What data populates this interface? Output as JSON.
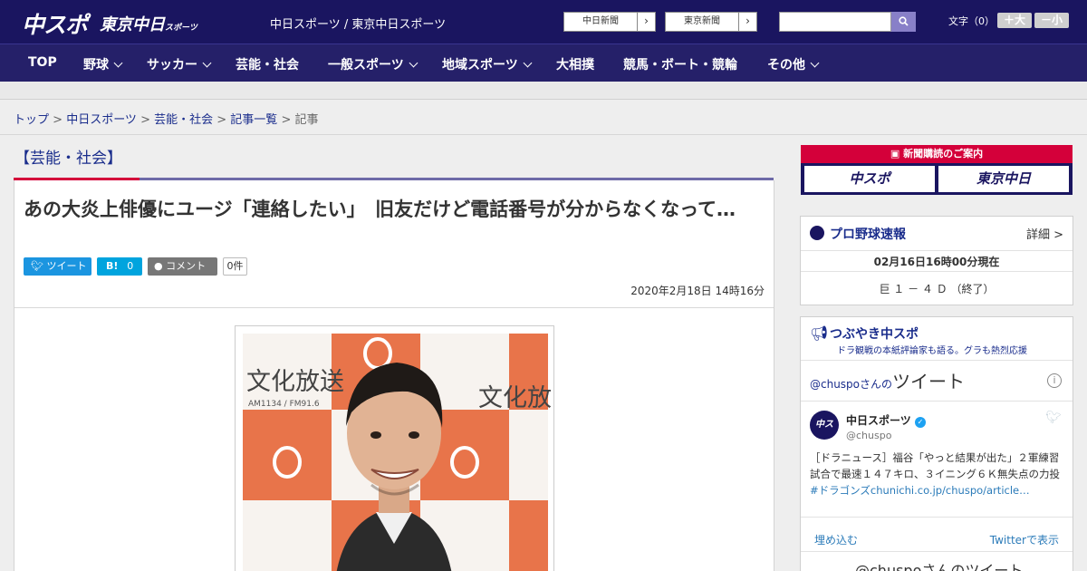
{
  "header": {
    "logo_main": "中スポ",
    "logo_tokyo": "東京中日",
    "logo_tokyo_small": "スポーツ",
    "site_title": "中日スポーツ / 東京中日スポーツ",
    "ext_links": [
      {
        "label": "中日新聞"
      },
      {
        "label": "東京新聞"
      }
    ],
    "search_placeholder": "",
    "fontsize_label": "文字（0）",
    "fontsize_up": "＋大",
    "fontsize_down": "－小"
  },
  "nav": {
    "items": [
      {
        "label": "TOP",
        "dropdown": false
      },
      {
        "label": "野球",
        "dropdown": true
      },
      {
        "label": "サッカー",
        "dropdown": true
      },
      {
        "label": "芸能・社会",
        "dropdown": false
      },
      {
        "label": "一般スポーツ",
        "dropdown": true
      },
      {
        "label": "地域スポーツ",
        "dropdown": true
      },
      {
        "label": "大相撲",
        "dropdown": false
      },
      {
        "label": "競馬・ボート・競輪",
        "dropdown": false
      },
      {
        "label": "その他",
        "dropdown": true
      }
    ]
  },
  "breadcrumb": {
    "items": [
      "トップ",
      "中日スポーツ",
      "芸能・社会",
      "記事一覧"
    ],
    "current": "記事",
    "sep": " > "
  },
  "article": {
    "category": "【芸能・社会】",
    "title": "あの大炎上俳優にユージ「連絡したい」　旧友だけど電話番号が分からなくなって…",
    "tweet_label": "ツイート",
    "hatena_label": "B!",
    "hatena_count": "0",
    "comment_label": "コメント",
    "comment_count": "0件",
    "date": "2020年2月18日 14時16分",
    "photo_text_1": "文化放送",
    "photo_text_2": "AM1134 / FM91.6",
    "photo_text_3": "文化放"
  },
  "sidebar": {
    "subscribe_header": "新聞購読のご案内",
    "subscribe_btns": [
      "中スポ",
      "東京中日"
    ],
    "baseball": {
      "title": "プロ野球速報",
      "detail": "詳細 >",
      "time": "02月16日16時00分現在",
      "score": "巨 １ － ４ Ｄ （終了）"
    },
    "tsubuyaki": {
      "title": "つぶやき中スポ",
      "subtitle": "ドラ観戦の本紙評論家も語る。グラも熱烈応援",
      "tweets_of_prefix": "@chuspoさんの",
      "tweets_of_word": "ツイート",
      "account_name": "中日スポーツ",
      "account_handle": "@chuspo",
      "tweet_text": "［ドラニュース］福谷「やっと結果が出た」２軍練習試合で最速１４７キロ、３イニング６Ｋ無失点の力投",
      "tweet_link": "#ドラゴンズchunichi.co.jp/chuspo/article…",
      "embed": "埋め込む",
      "view_on_twitter": "Twitterで表示",
      "footer_partial": "@chuspoさんのツイート"
    }
  },
  "colors": {
    "header_bg": "#1a1560",
    "nav_bg": "#252069",
    "accent_red": "#d4003a",
    "link_blue": "#1a2d8c"
  }
}
